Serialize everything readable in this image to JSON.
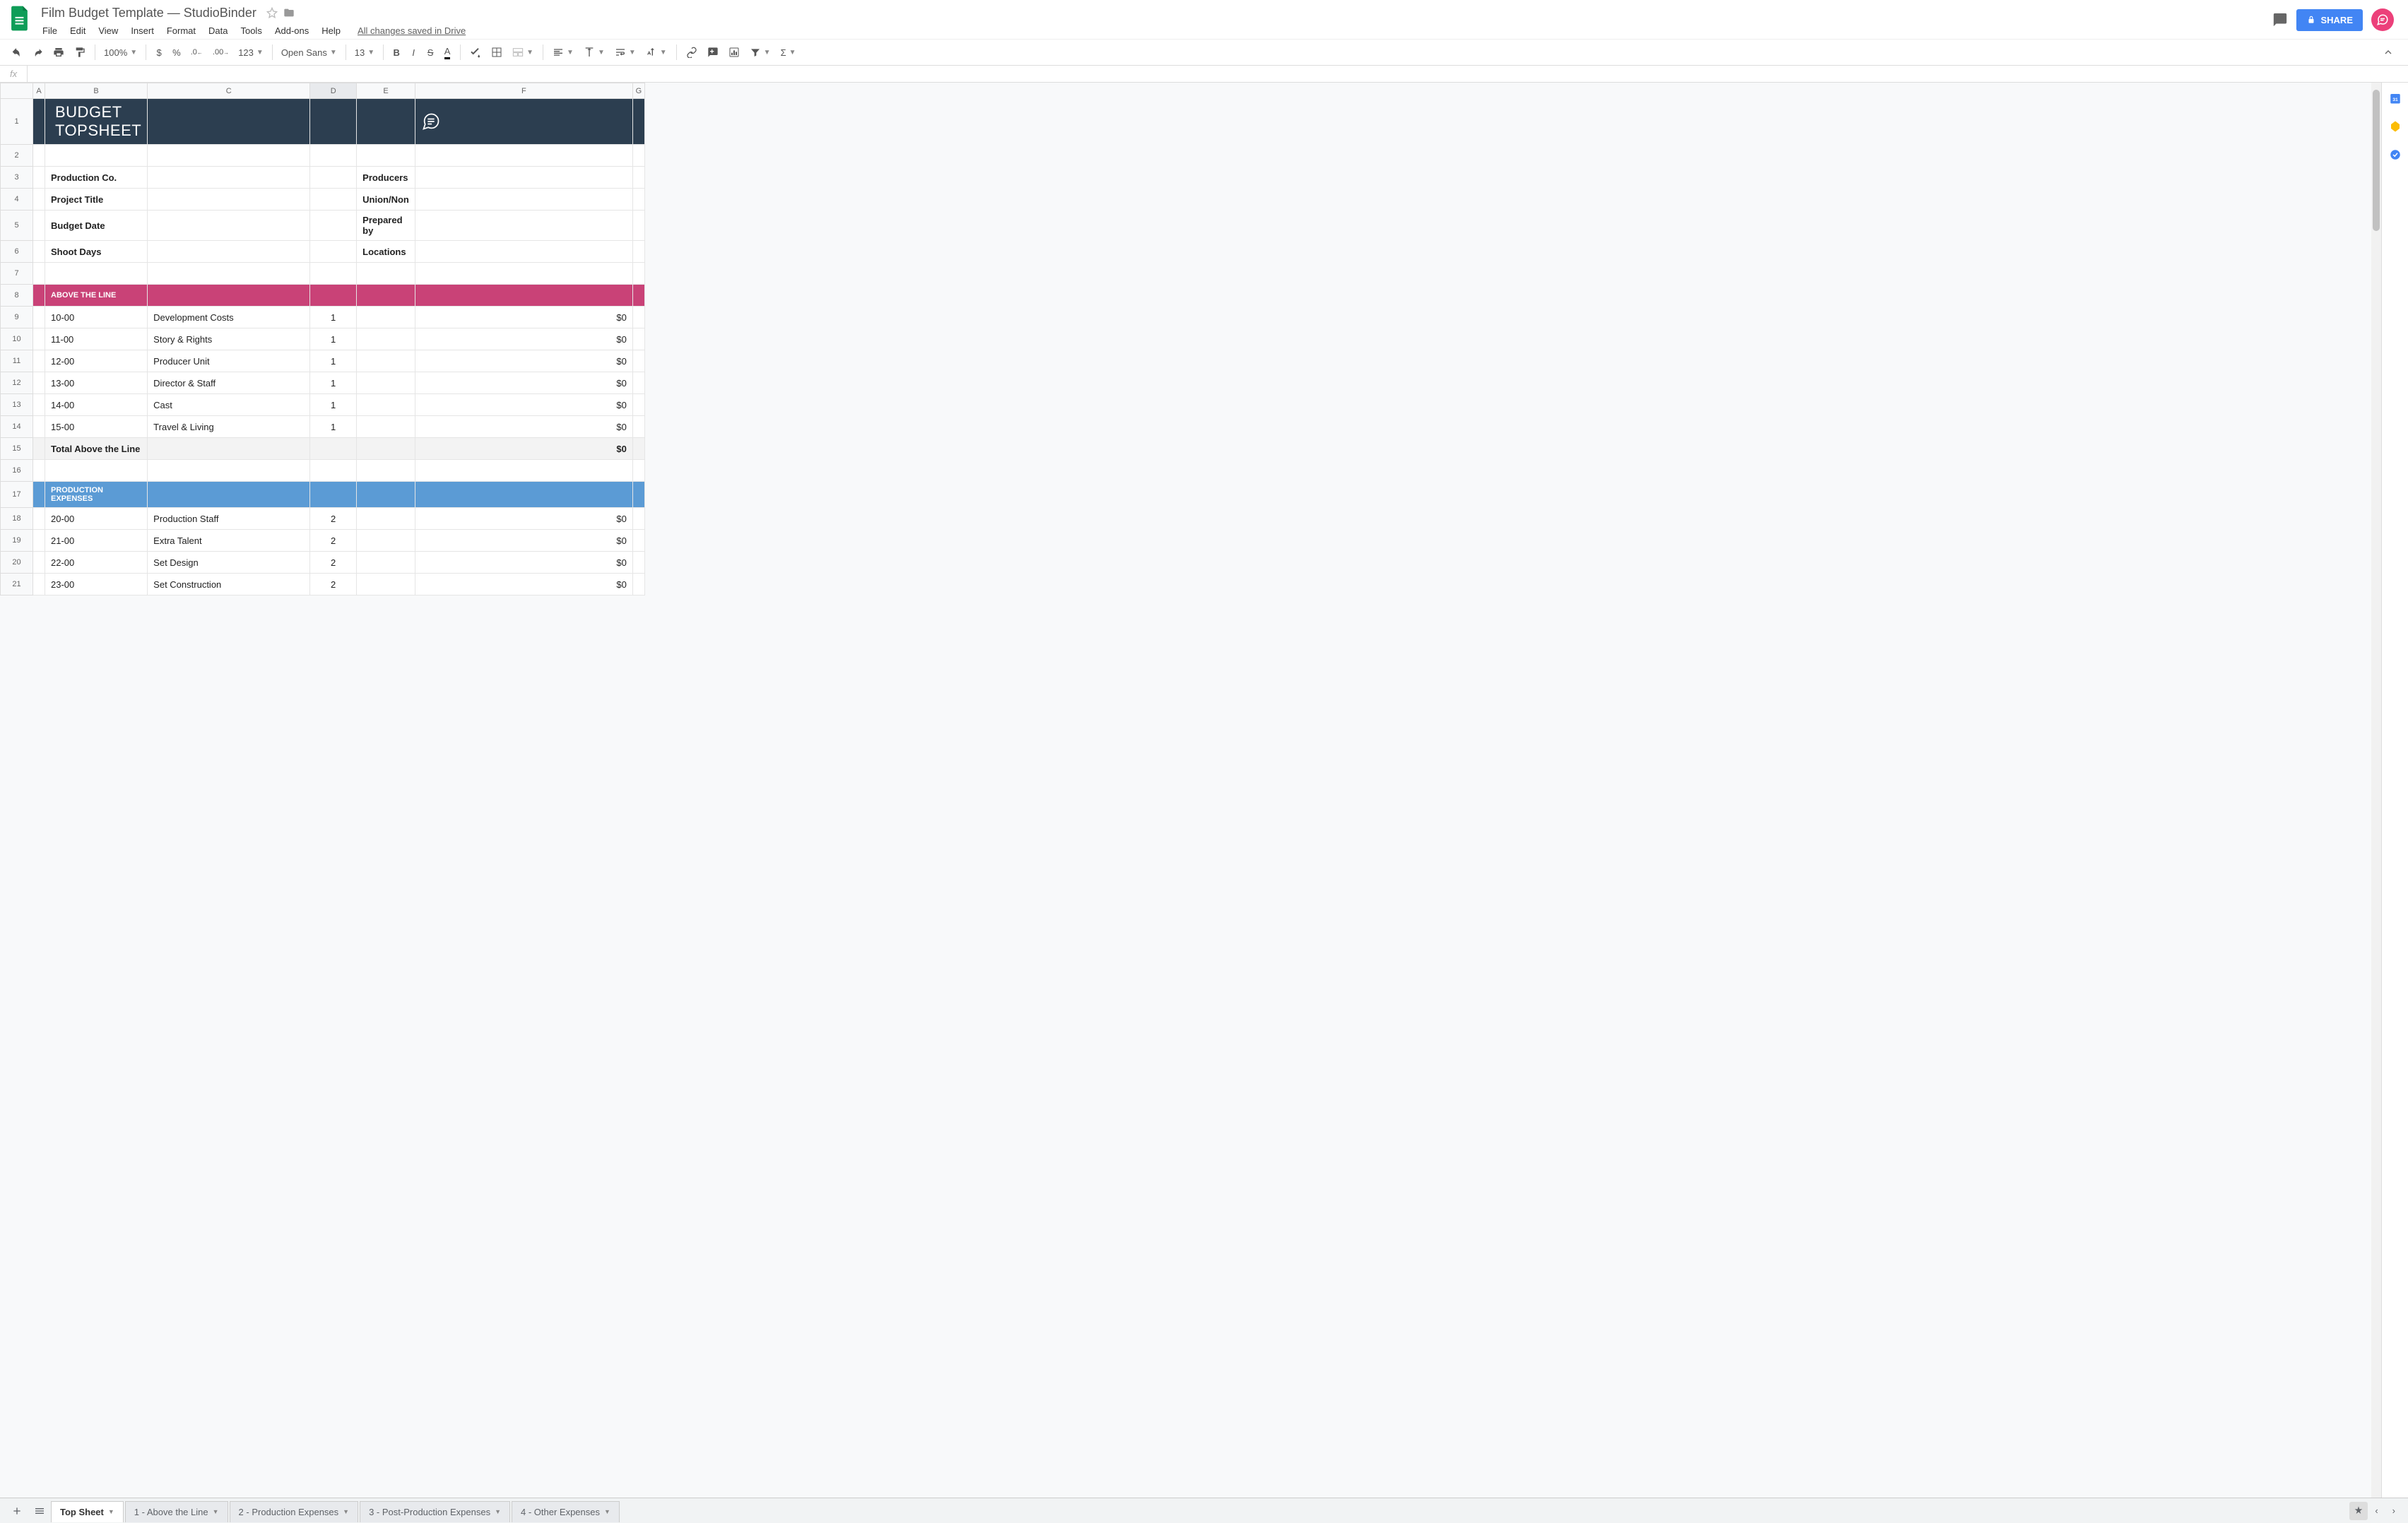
{
  "doc": {
    "title": "Film Budget Template — StudioBinder",
    "save_status": "All changes saved in Drive"
  },
  "menus": [
    "File",
    "Edit",
    "View",
    "Insert",
    "Format",
    "Data",
    "Tools",
    "Add-ons",
    "Help"
  ],
  "toolbar": {
    "zoom": "100%",
    "font": "Open Sans",
    "font_size": "13",
    "num_format": "123"
  },
  "share_label": "SHARE",
  "cols": [
    "",
    "A",
    "B",
    "C",
    "D",
    "E",
    "F",
    "G"
  ],
  "rows": {
    "title": "BUDGET TOPSHEET",
    "meta_left": [
      "Production Co.",
      "Project Title",
      "Budget Date",
      "Shoot Days"
    ],
    "meta_right": [
      "Producers",
      "Union/Non",
      "Prepared by",
      "Locations"
    ],
    "section1": "ABOVE THE LINE",
    "above_line": [
      {
        "code": "10-00",
        "desc": "Development Costs",
        "qty": "1",
        "amt": "$0"
      },
      {
        "code": "11-00",
        "desc": "Story & Rights",
        "qty": "1",
        "amt": "$0"
      },
      {
        "code": "12-00",
        "desc": "Producer Unit",
        "qty": "1",
        "amt": "$0"
      },
      {
        "code": "13-00",
        "desc": "Director & Staff",
        "qty": "1",
        "amt": "$0"
      },
      {
        "code": "14-00",
        "desc": "Cast",
        "qty": "1",
        "amt": "$0"
      },
      {
        "code": "15-00",
        "desc": "Travel & Living",
        "qty": "1",
        "amt": "$0"
      }
    ],
    "total_above": {
      "label": "Total Above the Line",
      "amt": "$0"
    },
    "section2": "PRODUCTION EXPENSES",
    "prod_exp": [
      {
        "code": "20-00",
        "desc": "Production Staff",
        "qty": "2",
        "amt": "$0"
      },
      {
        "code": "21-00",
        "desc": "Extra Talent",
        "qty": "2",
        "amt": "$0"
      },
      {
        "code": "22-00",
        "desc": "Set Design",
        "qty": "2",
        "amt": "$0"
      },
      {
        "code": "23-00",
        "desc": "Set Construction",
        "qty": "2",
        "amt": "$0"
      }
    ]
  },
  "row_nums": [
    "1",
    "2",
    "3",
    "4",
    "5",
    "6",
    "7",
    "8",
    "9",
    "10",
    "11",
    "12",
    "13",
    "14",
    "15",
    "16",
    "17",
    "18",
    "19",
    "20",
    "21"
  ],
  "tabs": [
    "Top Sheet",
    "1 - Above the Line",
    "2 - Production Expenses",
    "3 - Post-Production Expenses",
    "4 - Other Expenses"
  ]
}
